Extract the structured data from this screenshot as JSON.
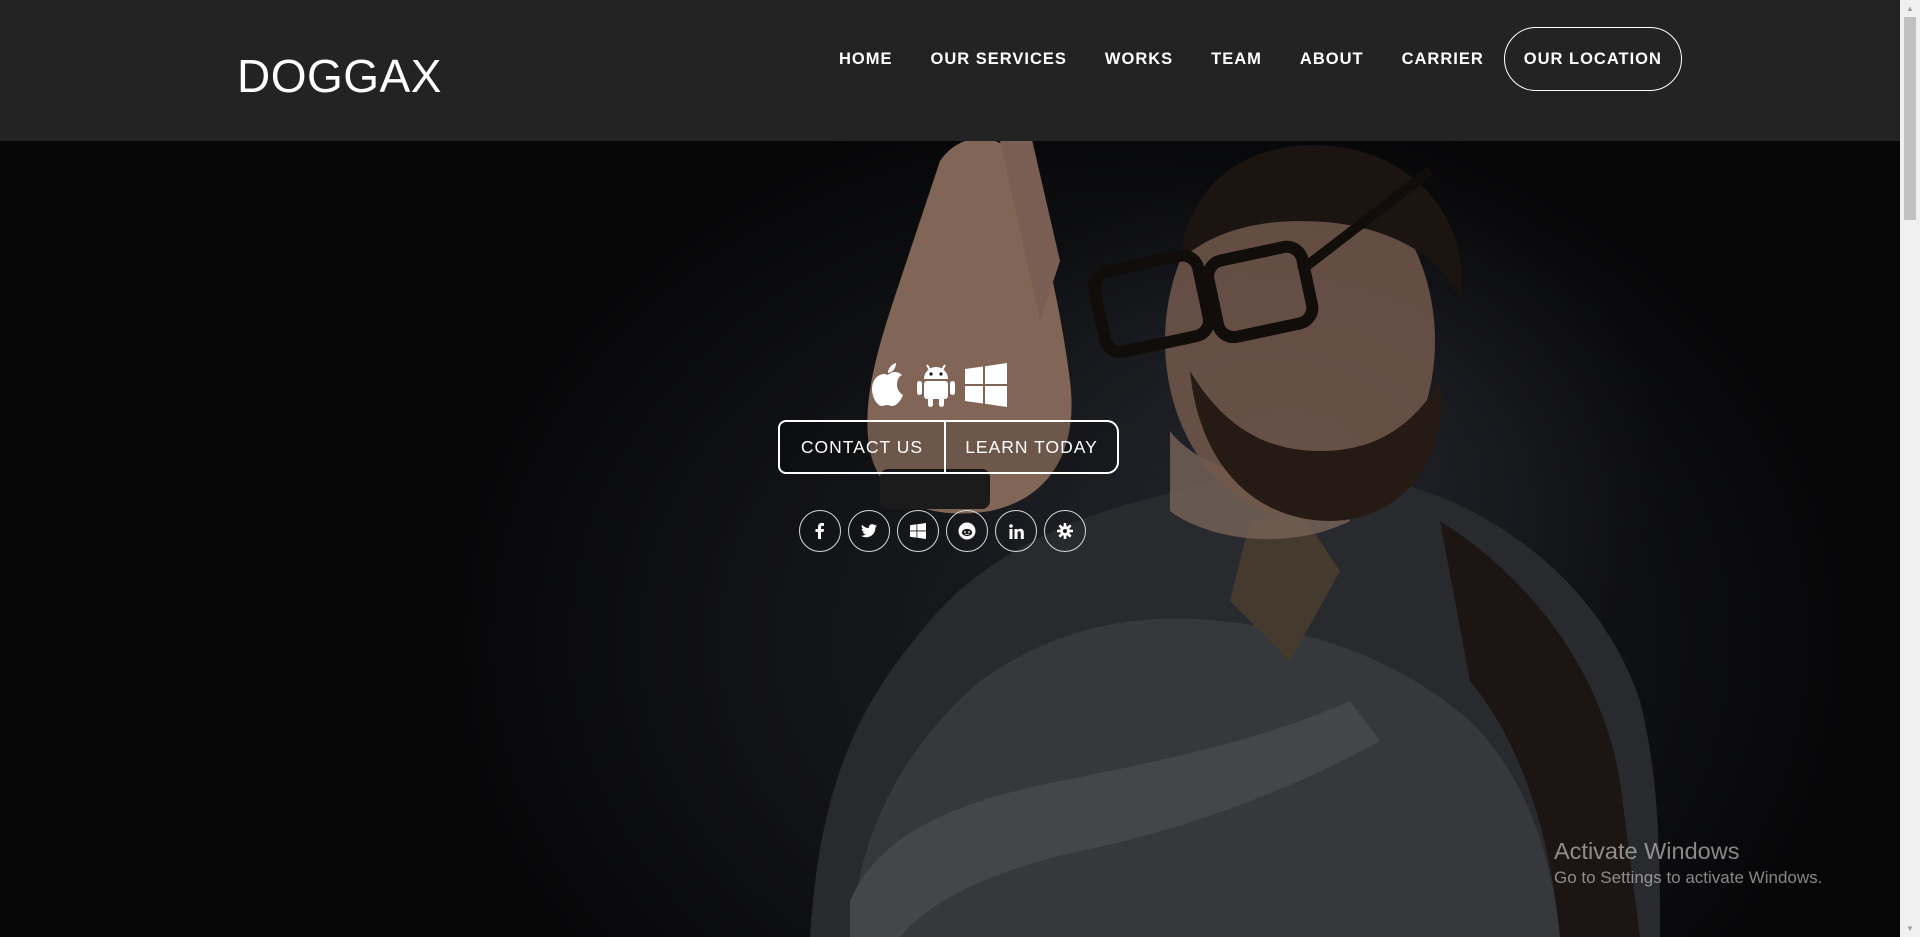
{
  "header": {
    "logo": "DOGGAX",
    "nav": [
      "HOME",
      "OUR SERVICES",
      "WORKS",
      "TEAM",
      "ABOUT",
      "CARRIER"
    ],
    "cta": "OUR LOCATION"
  },
  "hero": {
    "platform_icons": [
      "apple-icon",
      "android-icon",
      "windows-icon"
    ],
    "buttons": {
      "contact": "CONTACT US",
      "learn": "LEARN TODAY"
    },
    "social_icons": [
      "facebook-icon",
      "twitter-icon",
      "windows-icon",
      "reddit-icon",
      "linkedin-icon",
      "gear-icon"
    ],
    "social_glyphs": [
      "f",
      "t",
      "w",
      "r",
      "in",
      "g"
    ]
  },
  "watermark": {
    "title": "Activate Windows",
    "subtitle": "Go to Settings to activate Windows."
  },
  "colors": {
    "header_bg": "#232323",
    "text": "#ffffff"
  }
}
